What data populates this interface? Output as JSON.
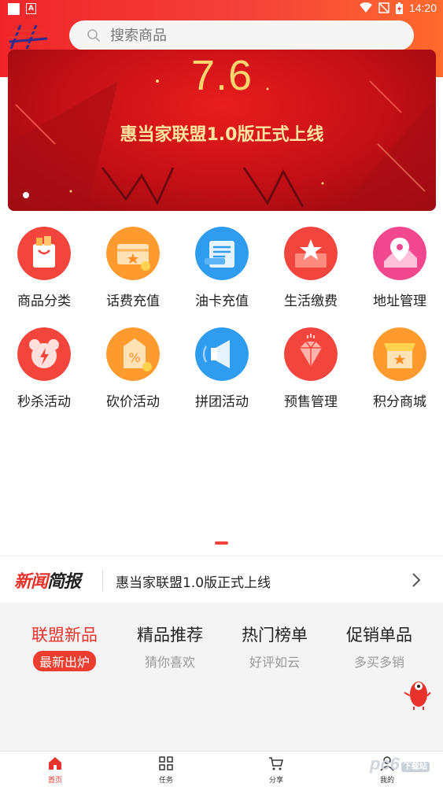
{
  "status_bar": {
    "time": "14:20"
  },
  "colors": {
    "brand_red": "#e8332c",
    "header_gradient_start": "#f0252a",
    "header_gradient_end": "#ff6a2d"
  },
  "search": {
    "placeholder": "搜索商品",
    "icon": "search-icon"
  },
  "banner": {
    "year_text": "7.6",
    "headline": "惠当家联盟1.0版正式上线",
    "current_slide": 1
  },
  "categories": [
    {
      "label": "商品分类",
      "icon": "shopping-bag-icon"
    },
    {
      "label": "话费充值",
      "icon": "phone-recharge-icon"
    },
    {
      "label": "油卡充值",
      "icon": "fuel-card-icon"
    },
    {
      "label": "生活缴费",
      "icon": "life-payment-icon"
    },
    {
      "label": "地址管理",
      "icon": "location-pin-icon"
    },
    {
      "label": "秒杀活动",
      "icon": "flash-sale-icon"
    },
    {
      "label": "砍价活动",
      "icon": "bargain-tag-icon"
    },
    {
      "label": "拼团活动",
      "icon": "group-buy-megaphone-icon"
    },
    {
      "label": "预售管理",
      "icon": "presale-diamond-icon"
    },
    {
      "label": "积分商城",
      "icon": "points-store-icon"
    }
  ],
  "news": {
    "logo_part1": "新闻",
    "logo_part2": "简报",
    "headline": "惠当家联盟1.0版正式上线"
  },
  "feed_tabs": [
    {
      "title": "联盟新品",
      "subtitle": "最新出炉",
      "active": true
    },
    {
      "title": "精品推荐",
      "subtitle": "猜你喜欢",
      "active": false
    },
    {
      "title": "热门榜单",
      "subtitle": "好评如云",
      "active": false
    },
    {
      "title": "促销单品",
      "subtitle": "多买多销",
      "active": false
    }
  ],
  "bottom_nav": [
    {
      "label": "首页",
      "icon": "home-icon",
      "active": true
    },
    {
      "label": "任务",
      "icon": "grid-icon",
      "active": false
    },
    {
      "label": "分享",
      "icon": "cart-icon",
      "active": false
    },
    {
      "label": "我的",
      "icon": "user-icon",
      "active": false
    }
  ],
  "watermark": {
    "text": "pc6",
    "badge": "下载站"
  }
}
